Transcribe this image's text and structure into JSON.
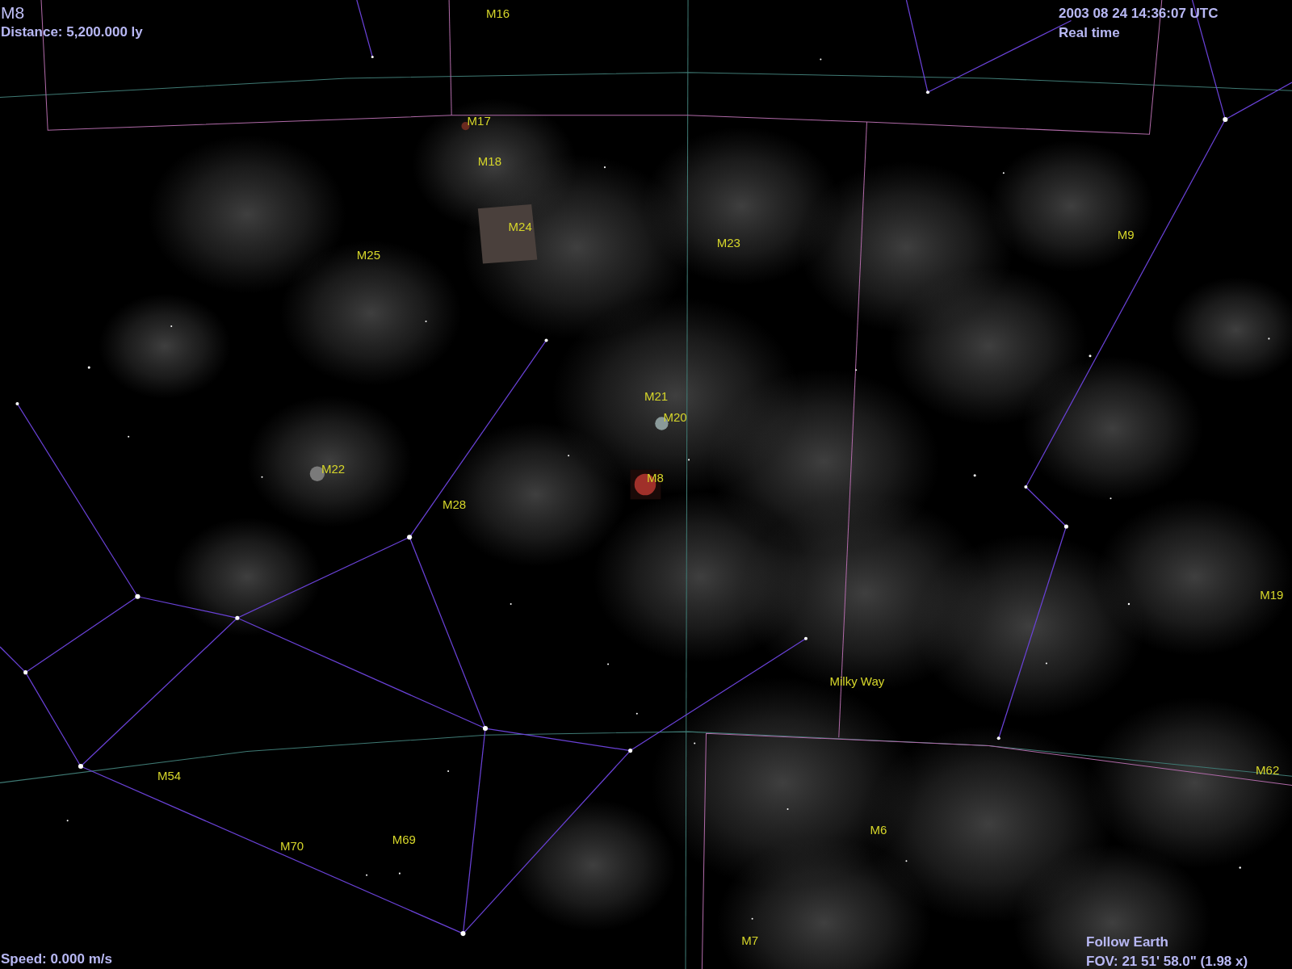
{
  "hud": {
    "object_name": "M8",
    "distance": "Distance: 5,200.000 ly",
    "datetime": "2003 08 24 14:36:07 UTC",
    "time_mode": "Real time",
    "speed": "Speed: 0.000 m/s",
    "follow": "Follow Earth",
    "fov": "FOV: 21 51' 58.0\" (1.98 x)"
  },
  "labels": [
    {
      "text": "M16"
    },
    {
      "text": "M17"
    },
    {
      "text": "M18"
    },
    {
      "text": "M24"
    },
    {
      "text": "M25"
    },
    {
      "text": "M23"
    },
    {
      "text": "M9"
    },
    {
      "text": "M21"
    },
    {
      "text": "M20"
    },
    {
      "text": "M8"
    },
    {
      "text": "M22"
    },
    {
      "text": "M28"
    },
    {
      "text": "M19"
    },
    {
      "text": "Milky Way"
    },
    {
      "text": "M54"
    },
    {
      "text": "M62"
    },
    {
      "text": "M6"
    },
    {
      "text": "M70"
    },
    {
      "text": "M69"
    },
    {
      "text": "M7"
    }
  ]
}
